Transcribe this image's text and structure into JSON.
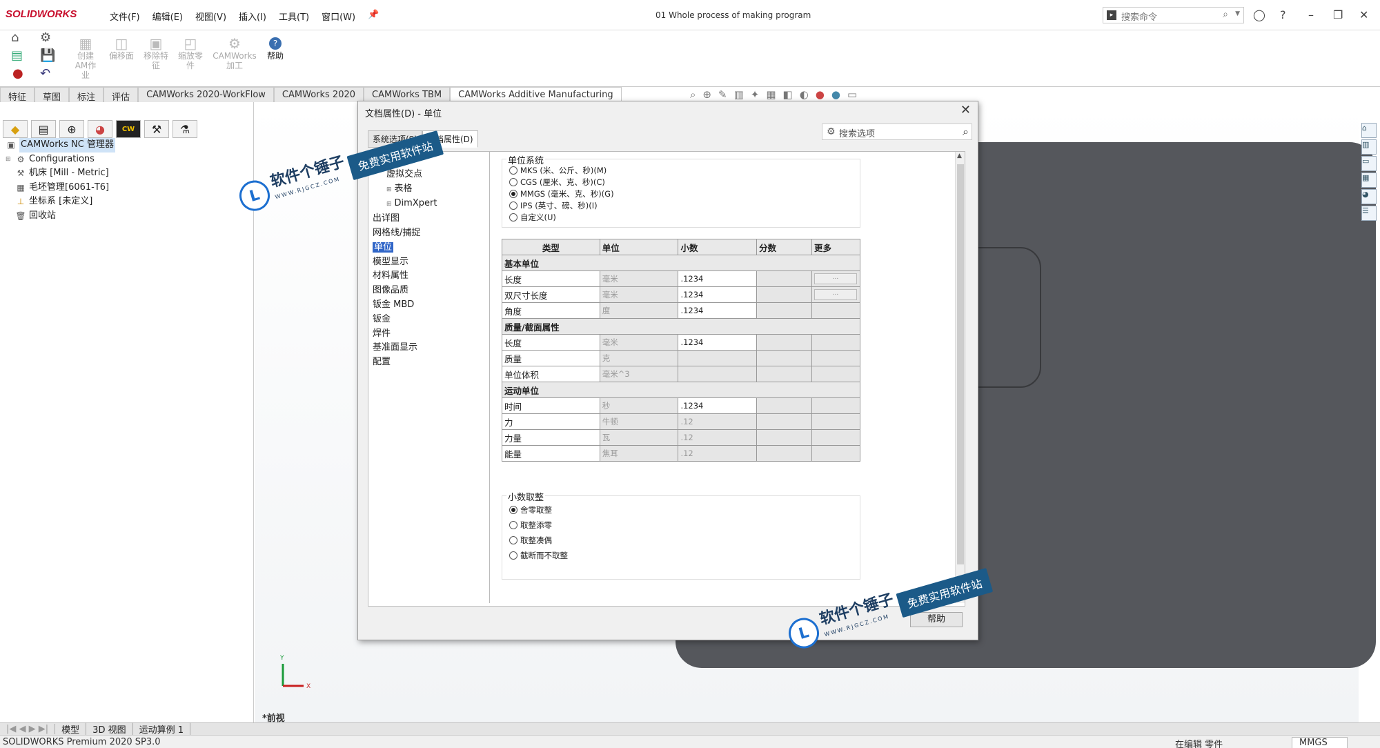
{
  "app": {
    "logo": "SOLIDWORKS",
    "menus": [
      "文件(F)",
      "编辑(E)",
      "视图(V)",
      "插入(I)",
      "工具(T)",
      "窗口(W)"
    ],
    "document_title": "01 Whole process of making program",
    "search_placeholder": "搜索命令"
  },
  "ribbon": {
    "buttons": [
      {
        "label": "创建AM作业",
        "icon": "create-am-job-icon"
      },
      {
        "label": "偏移面",
        "icon": "offset-face-icon"
      },
      {
        "label": "移除特征",
        "icon": "remove-feature-icon"
      },
      {
        "label": "缩放零件",
        "icon": "scale-part-icon"
      },
      {
        "label": "CAMWorks加工",
        "icon": "camworks-machining-icon"
      },
      {
        "label": "帮助",
        "icon": "help-icon"
      }
    ]
  },
  "tabs": [
    "特征",
    "草图",
    "标注",
    "评估",
    "CAMWorks 2020-WorkFlow",
    "CAMWorks 2020",
    "CAMWorks TBM",
    "CAMWorks Additive Manufacturing"
  ],
  "tree": {
    "root": "CAMWorks NC 管理器",
    "items": [
      "Configurations",
      "机床 [Mill - Metric]",
      "毛坯管理[6061-T6]",
      "坐标系 [未定义]",
      "回收站"
    ]
  },
  "graphics": {
    "view_label": "*前视",
    "axis_y": "Y",
    "axis_x": "X"
  },
  "bottom_tabs": [
    "模型",
    "3D 视图",
    "运动算例 1"
  ],
  "status": {
    "product": "SOLIDWORKS Premium 2020 SP3.0",
    "editing": "在编辑 零件",
    "units": "MMGS"
  },
  "dialog": {
    "title": "文档属性(D) - 单位",
    "tabs": [
      "系统选项(S)",
      "文档属性(D)"
    ],
    "search_placeholder": "搜索选项",
    "options": [
      {
        "label": "绘图标",
        "indent": false,
        "expander": false,
        "selected": false
      },
      {
        "label": "虚拟交点",
        "indent": true,
        "expander": false,
        "selected": false
      },
      {
        "label": "表格",
        "indent": true,
        "expander": true,
        "selected": false
      },
      {
        "label": "DimXpert",
        "indent": true,
        "expander": true,
        "selected": false
      },
      {
        "label": "出详图",
        "indent": false,
        "expander": false,
        "selected": false
      },
      {
        "label": "网格线/捕捉",
        "indent": false,
        "expander": false,
        "selected": false
      },
      {
        "label": "单位",
        "indent": false,
        "expander": false,
        "selected": true
      },
      {
        "label": "模型显示",
        "indent": false,
        "expander": false,
        "selected": false
      },
      {
        "label": "材料属性",
        "indent": false,
        "expander": false,
        "selected": false
      },
      {
        "label": "图像品质",
        "indent": false,
        "expander": false,
        "selected": false
      },
      {
        "label": "钣金 MBD",
        "indent": false,
        "expander": false,
        "selected": false
      },
      {
        "label": "钣金",
        "indent": false,
        "expander": false,
        "selected": false
      },
      {
        "label": "焊件",
        "indent": false,
        "expander": false,
        "selected": false
      },
      {
        "label": "基准面显示",
        "indent": false,
        "expander": false,
        "selected": false
      },
      {
        "label": "配置",
        "indent": false,
        "expander": false,
        "selected": false
      }
    ],
    "unit_system": {
      "label": "单位系统",
      "choices": [
        "MKS (米、公斤、秒)(M)",
        "CGS (厘米、克、秒)(C)",
        "MMGS (毫米、克、秒)(G)",
        "IPS (英寸、磅、秒)(I)",
        "自定义(U)"
      ],
      "selected_index": 2
    },
    "table": {
      "headers": [
        "类型",
        "单位",
        "小数",
        "分数",
        "更多"
      ],
      "sections": [
        {
          "title": "基本单位",
          "rows": [
            {
              "type": "长度",
              "unit": "毫米",
              "decimals": ".1234",
              "dec_enabled": true,
              "more": "..."
            },
            {
              "type": "双尺寸长度",
              "unit": "毫米",
              "decimals": ".1234",
              "dec_enabled": true,
              "more": "..."
            },
            {
              "type": "角度",
              "unit": "度",
              "decimals": ".1234",
              "dec_enabled": true,
              "more": ""
            }
          ]
        },
        {
          "title": "质量/截面属性",
          "rows": [
            {
              "type": "长度",
              "unit": "毫米",
              "decimals": ".1234",
              "dec_enabled": true,
              "more": ""
            },
            {
              "type": "质量",
              "unit": "克",
              "decimals": "",
              "dec_enabled": false,
              "more": ""
            },
            {
              "type": "单位体积",
              "unit": "毫米^3",
              "decimals": "",
              "dec_enabled": false,
              "more": ""
            }
          ]
        },
        {
          "title": "运动单位",
          "rows": [
            {
              "type": "时间",
              "unit": "秒",
              "decimals": ".1234",
              "dec_enabled": true,
              "more": ""
            },
            {
              "type": "力",
              "unit": "牛顿",
              "decimals": ".12",
              "dec_enabled": false,
              "more": ""
            },
            {
              "type": "力量",
              "unit": "瓦",
              "decimals": ".12",
              "dec_enabled": false,
              "more": ""
            },
            {
              "type": "能量",
              "unit": "焦耳",
              "decimals": ".12",
              "dec_enabled": false,
              "more": ""
            }
          ]
        }
      ]
    },
    "rounding": {
      "label": "小数取整",
      "choices": [
        "舍零取整",
        "取整添零",
        "取整凑偶",
        "截断而不取整"
      ],
      "selected_index": 0
    },
    "help_button": "帮助"
  },
  "watermark": {
    "name": "软件个锤子",
    "url": "WWW.RJGCZ.COM",
    "slogan": "免费实用软件站"
  },
  "colors": {
    "brand_red": "#c8102e",
    "selection_blue": "#3166c8",
    "part_gray": "#55575c",
    "watermark_blue": "#1b5a88"
  }
}
